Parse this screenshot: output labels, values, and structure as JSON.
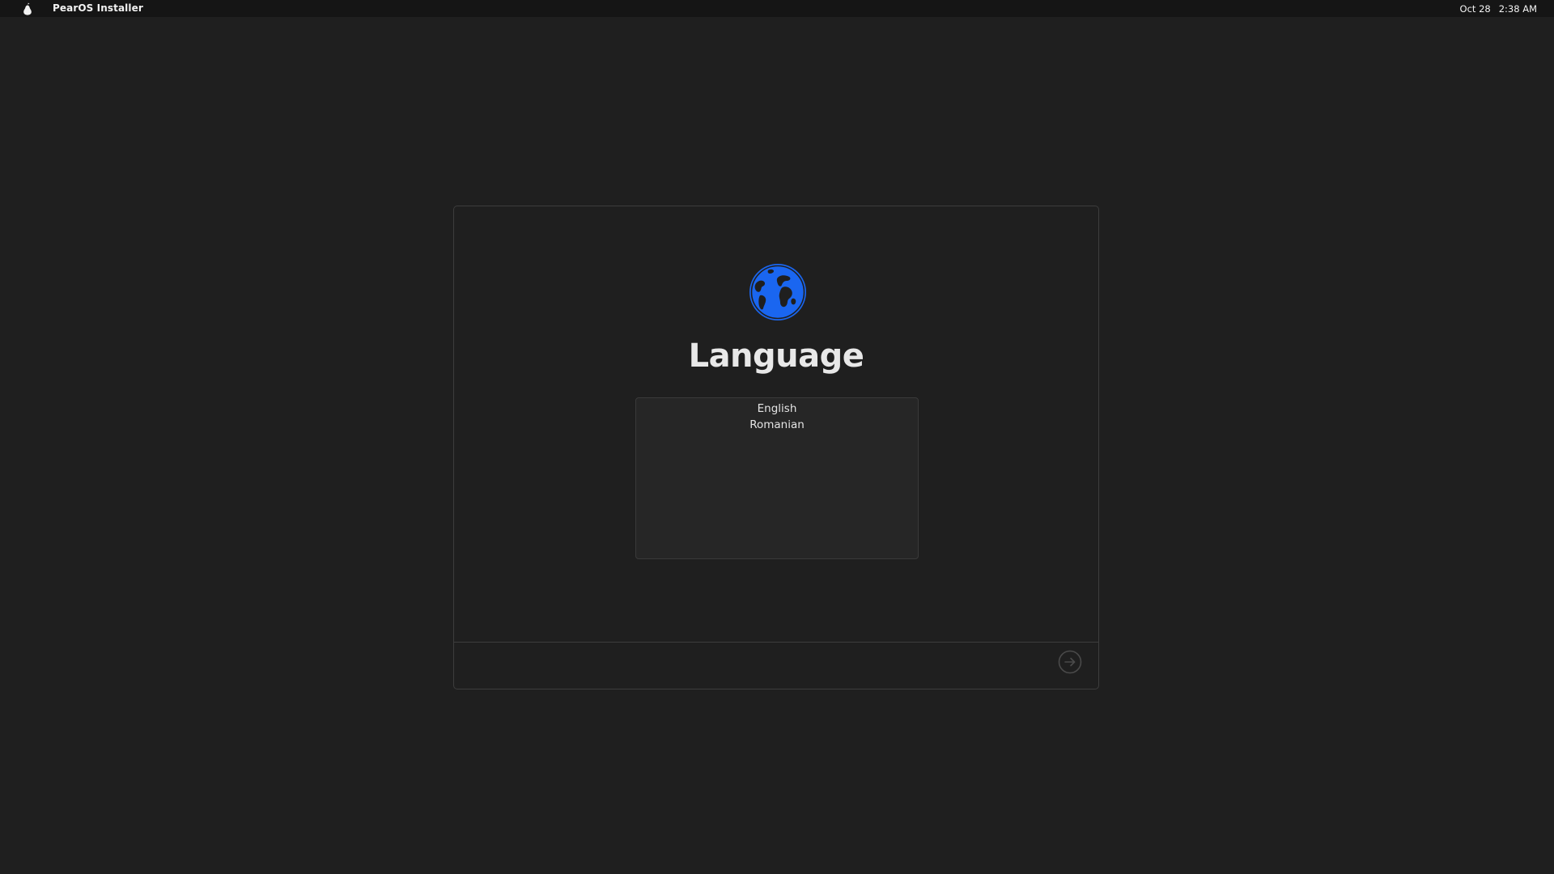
{
  "menubar": {
    "app_icon": "pear-logo-icon",
    "app_name": "PearOS Installer",
    "date": "Oct 28",
    "time": "2:38 AM"
  },
  "installer": {
    "icon": "globe-icon",
    "title": "Language",
    "languages": [
      "English",
      "Romanian"
    ],
    "next_icon": "arrow-right-circle-icon"
  },
  "colors": {
    "background": "#1f1f1f",
    "menubar": "#151515",
    "accent": "#1a66f0",
    "border": "#3d3d3d"
  }
}
